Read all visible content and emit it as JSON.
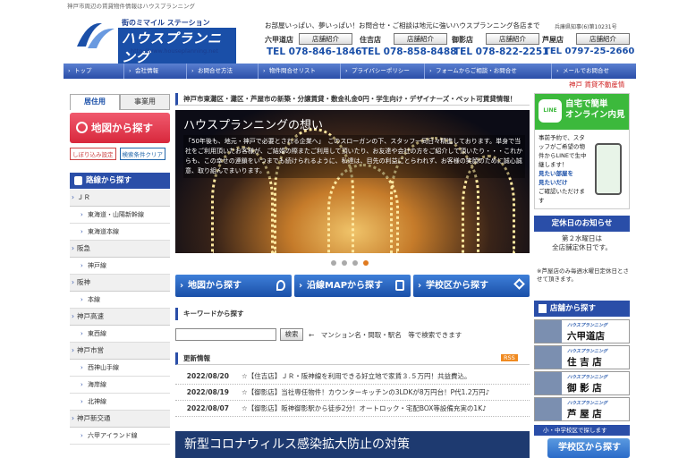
{
  "top_line": "神戸市周辺の賃貸物件情報はハウスプランニング",
  "logo": {
    "tagline": "街のミマイル ステーション",
    "brand": "ハウスプランニング",
    "url": "http://www.houseplanning.net"
  },
  "slogan": "お部屋いっぱい、夢いっぱい！お問合せ・ご相談は地元に強いハウスプランニング各店まで",
  "license": "兵庫県知事(6)第10231号",
  "stores": [
    {
      "name": "六甲道店",
      "button": "店舗紹介",
      "tel": "TEL 078-846-1846"
    },
    {
      "name": "住吉店",
      "button": "店舗紹介",
      "tel": "TEL 078-858-8488"
    },
    {
      "name": "御影店",
      "button": "店舗紹介",
      "tel": "TEL 078-822-2251"
    },
    {
      "name": "芦屋店",
      "button": "店舗紹介",
      "tel": "TEL 0797-25-2660"
    }
  ],
  "nav": [
    "トップ",
    "会社情報",
    "お問合せ方法",
    "物件問合せリスト",
    "プライバシーポリシー",
    "フォームからご相談・お問合せ",
    "メールでお問合せ"
  ],
  "marquee": "神戸 賃貸不動産情",
  "tabs": {
    "residential": "居住用",
    "business": "事業用"
  },
  "map_button": "地図から探す",
  "small_buttons": {
    "narrow": "しぼり込み設定",
    "clear": "検索条件クリア"
  },
  "route_heading": "路線から探す",
  "routes": [
    {
      "category": "ＪＲ",
      "lines": [
        "東海道・山陽新幹線",
        "東海道本線"
      ]
    },
    {
      "category": "阪急",
      "lines": [
        "神戸線"
      ]
    },
    {
      "category": "阪神",
      "lines": [
        "本線"
      ]
    },
    {
      "category": "神戸高速",
      "lines": [
        "東西線"
      ]
    },
    {
      "category": "神戸市営",
      "lines": [
        "西神山手線",
        "海岸線",
        "北神線"
      ]
    },
    {
      "category": "神戸新交通",
      "lines": [
        "六甲アイランド線"
      ]
    }
  ],
  "headline": "神戸市東灘区・灘区・芦屋市の新築・分譲賃貸・敷金礼金0円・学生向け・デザイナーズ・ペット可賃貸情報！",
  "hero": {
    "title": "ハウスプランニングの想い",
    "text": "「50年後も、地元・神戸で必要とされる企業へ」　このスローガンの下、スタッフ一同日々精進しております。単身で当社をご利用頂いたお客様が、ご結婚の際またご利用して頂いたり、お友達や会社の方をご紹介して頂いたり・・・これからも、この幸せの連鎖をいつまでも続けられるように、私達は、目先の利益にとらわれず、お客様の笑顔のために誠心誠意、取り組んでまいります。"
  },
  "big_buttons": [
    "地図から探す",
    "沿線MAPから探す",
    "学校区から探す"
  ],
  "keyword": {
    "heading": "キーワードから探す",
    "button": "検索",
    "note": "←　マンション名・間取・駅名　等で検索できます"
  },
  "updates": {
    "heading": "更新情報",
    "rss": "RSS",
    "items": [
      {
        "date": "2022/08/20",
        "text": "☆【住吉店】ＪＲ・阪神線を利用できる好立地で家賃３.５万円！共益費込。"
      },
      {
        "date": "2022/08/19",
        "text": "☆【御影店】当社専任物件！カウンターキッチンの3LDKが8万円台！P代1.2万円♪"
      },
      {
        "date": "2022/08/07",
        "text": "☆【御影店】阪神御影駅から徒歩2分！オートロック・宅配BOX等設備充実の1K♪"
      }
    ]
  },
  "covid_banner": "新型コロナウィルス感染拡大防止の対策",
  "line_box": {
    "title": "自宅で簡単\nオンライン内見",
    "logo": "LINE",
    "body_1": "事前予約で、スタッフがご希望の物件からLINEで生中継します！",
    "body_2": "見たい部屋を",
    "body_3": "見たいだけ",
    "body_4": "ご確認いただけます"
  },
  "holiday": {
    "heading": "定休日のお知らせ",
    "line1": "第２水曜日は",
    "line2": "全店舗定休日です。",
    "note": "※芦屋店のみ毎週水曜日定休日とさせて頂きます。"
  },
  "shop_heading": "店舗から探す",
  "shops": [
    {
      "brand": "ハウスプランニング",
      "name": "六甲道店"
    },
    {
      "brand": "ハウスプランニング",
      "name": "住 吉 店"
    },
    {
      "brand": "ハウスプランニング",
      "name": "御 影 店"
    },
    {
      "brand": "ハウスプランニング",
      "name": "芦 屋 店"
    }
  ],
  "school": {
    "heading": "小・中学校区で探します",
    "button": "学校区から探す"
  },
  "colors": {
    "primary": "#2a4ea8",
    "accent_red": "#d8283c",
    "line_green": "#3cb93c"
  }
}
